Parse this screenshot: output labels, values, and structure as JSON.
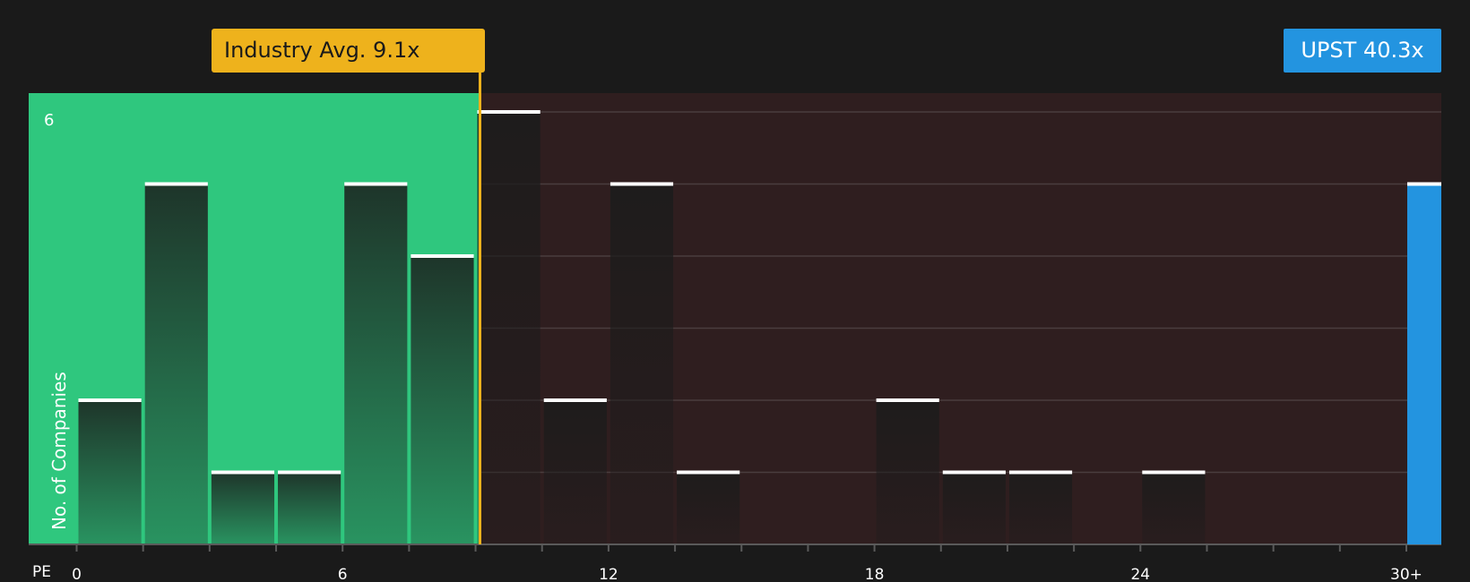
{
  "chart_data": {
    "type": "bar",
    "xlabel": "PE",
    "ylabel": "No. of Companies",
    "x_tick_labels": [
      "0",
      "6",
      "12",
      "18",
      "24",
      "30+"
    ],
    "y_tick_labels": [
      "6"
    ],
    "ylim": [
      0,
      6
    ],
    "xlim": [
      0,
      30.5
    ],
    "bin_width": 1.5,
    "bins": [
      {
        "x_start": 0,
        "x_end": 1.5,
        "count": 2
      },
      {
        "x_start": 1.5,
        "x_end": 3,
        "count": 5
      },
      {
        "x_start": 3,
        "x_end": 4.5,
        "count": 1
      },
      {
        "x_start": 4.5,
        "x_end": 6,
        "count": 1
      },
      {
        "x_start": 6,
        "x_end": 7.5,
        "count": 5
      },
      {
        "x_start": 7.5,
        "x_end": 9,
        "count": 4
      },
      {
        "x_start": 9,
        "x_end": 10.5,
        "count": 6
      },
      {
        "x_start": 10.5,
        "x_end": 12,
        "count": 2
      },
      {
        "x_start": 12,
        "x_end": 13.5,
        "count": 5
      },
      {
        "x_start": 13.5,
        "x_end": 15,
        "count": 1
      },
      {
        "x_start": 18,
        "x_end": 19.5,
        "count": 2
      },
      {
        "x_start": 19.5,
        "x_end": 21,
        "count": 1
      },
      {
        "x_start": 21,
        "x_end": 22.5,
        "count": 1
      },
      {
        "x_start": 24,
        "x_end": 25.5,
        "count": 1
      }
    ],
    "industry_average": {
      "value": 9.1,
      "label": "Industry Avg. 9.1x"
    },
    "company": {
      "ticker": "UPST",
      "value": 40.3,
      "label": "UPST 40.3x",
      "count": 5
    },
    "grid": true,
    "colors": {
      "below_average_zone": "#2fc77e",
      "above_average_zone": "#2f1e1f",
      "industry_marker": "#eeb21c",
      "company_bar": "#2394e0",
      "bar_cap": "#ffffff",
      "background": "#1a1a1a"
    }
  }
}
